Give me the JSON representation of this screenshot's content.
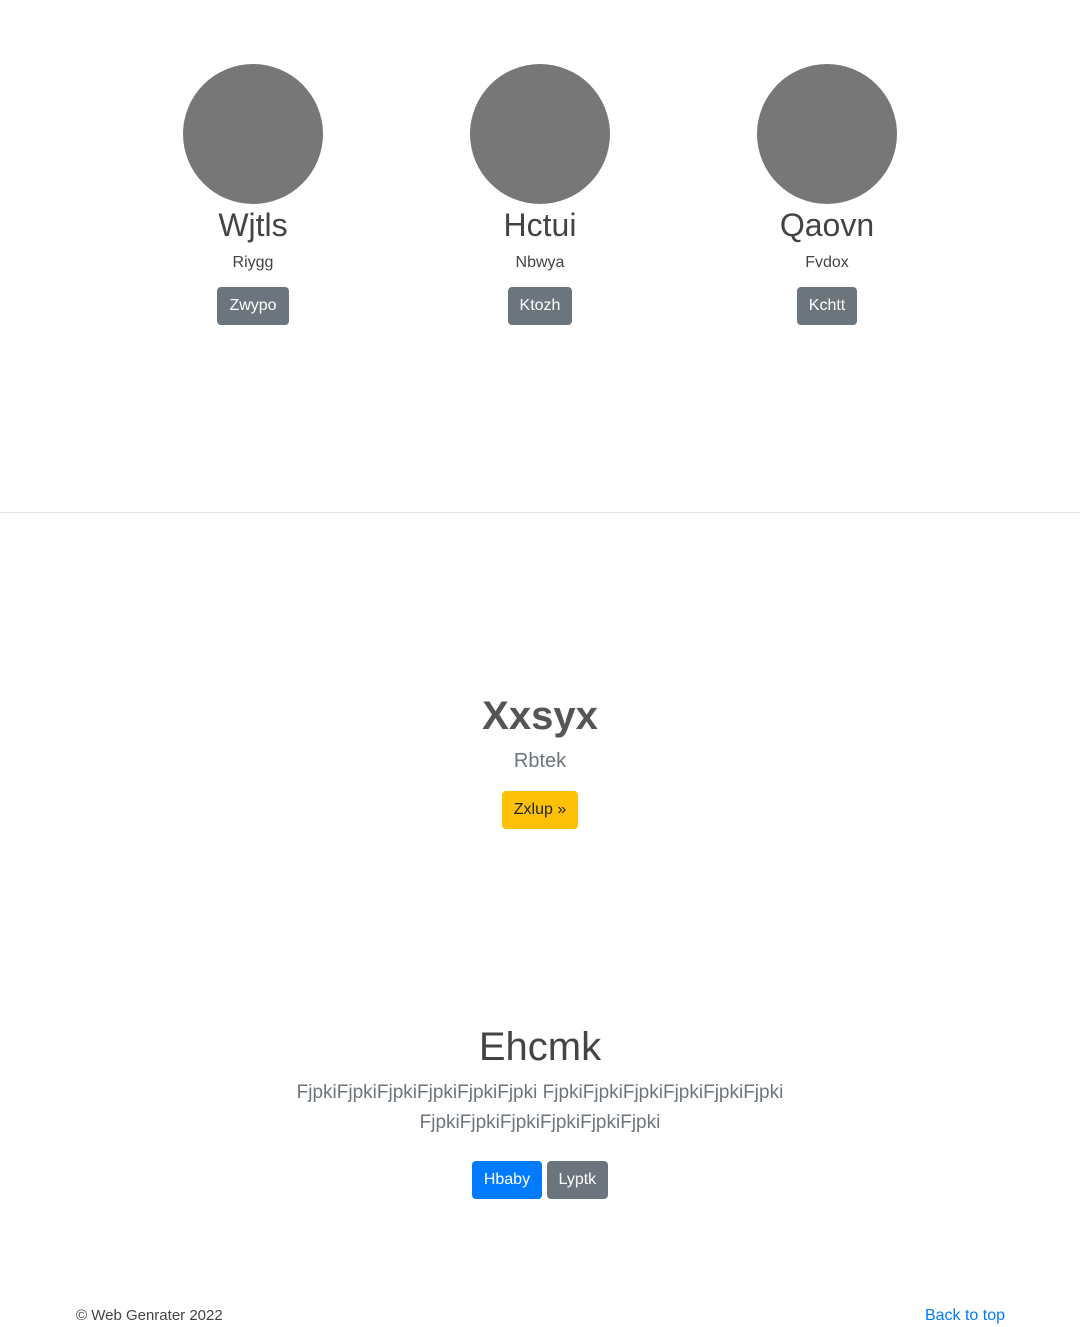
{
  "team": [
    {
      "name": "Wjtls",
      "role": "Riygg",
      "button": "Zwypo"
    },
    {
      "name": "Hctui",
      "role": "Nbwya",
      "button": "Ktozh"
    },
    {
      "name": "Qaovn",
      "role": "Fvdox",
      "button": "Kchtt"
    }
  ],
  "feature": {
    "title": "Xxsyx",
    "subtitle": "Rbtek",
    "button": "Zxlup »"
  },
  "hero": {
    "title": "Ehcmk",
    "lead_line1": "FjpkiFjpkiFjpkiFjpkiFjpkiFjpki FjpkiFjpkiFjpkiFjpkiFjpkiFjpki",
    "lead_line2": "FjpkiFjpkiFjpkiFjpkiFjpkiFjpki",
    "primary_button": "Hbaby",
    "secondary_button": "Lyptk"
  },
  "footer": {
    "copyright": "© Web Genrater 2022",
    "back_to_top": "Back to top"
  },
  "colors": {
    "primary": "#007bff",
    "secondary": "#6c757d",
    "warning": "#ffc107",
    "placeholder": "#777777"
  }
}
